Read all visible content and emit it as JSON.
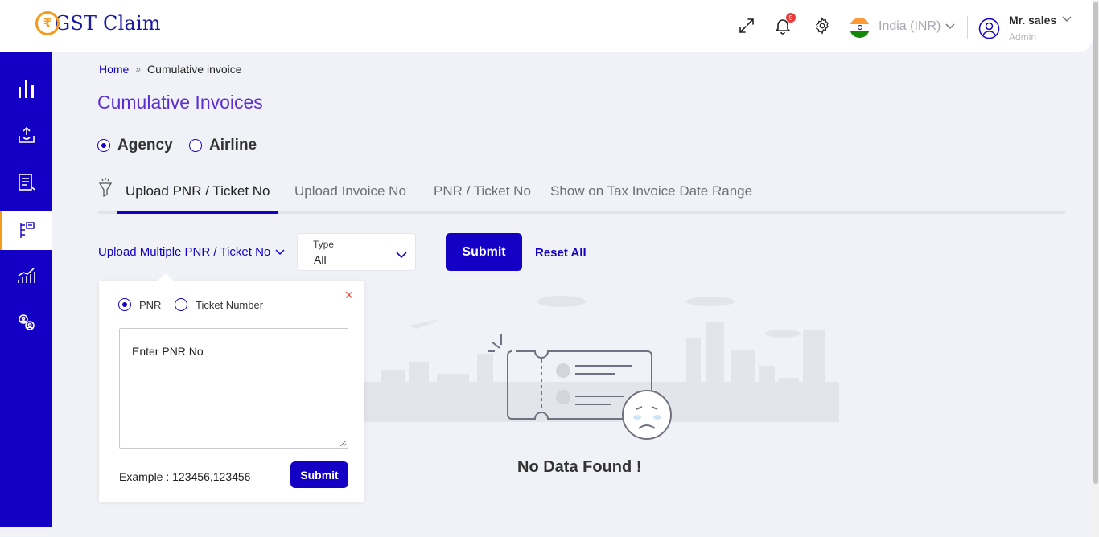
{
  "header": {
    "logo_text": "GST Claim",
    "logo_symbol": "₹",
    "notification_count": "5",
    "country": "India (INR)",
    "user_name": "Mr. sales",
    "user_role": "Admin"
  },
  "sidebar": {
    "items": [
      {
        "name": "dashboard",
        "icon": "bar-chart-icon"
      },
      {
        "name": "upload",
        "icon": "upload-tray-icon"
      },
      {
        "name": "invoice",
        "icon": "document-icon"
      },
      {
        "name": "cumulative-invoice",
        "icon": "cumulative-invoice-icon",
        "active": true
      },
      {
        "name": "reports",
        "icon": "growth-chart-icon"
      },
      {
        "name": "users",
        "icon": "users-icon"
      }
    ]
  },
  "breadcrumb": {
    "home": "Home",
    "separator": "»",
    "current": "Cumulative invoice"
  },
  "page_title": "Cumulative Invoices",
  "entity_options": {
    "agency": "Agency",
    "airline": "Airline",
    "selected": "Agency"
  },
  "tabs": [
    {
      "label": "Upload PNR / Ticket No",
      "active": true
    },
    {
      "label": "Upload Invoice No",
      "active": false
    },
    {
      "label": "PNR / Ticket No",
      "active": false
    },
    {
      "label": "Show on Tax Invoice Date Range",
      "active": false
    }
  ],
  "filters": {
    "upload_dropdown": "Upload Multiple PNR / Ticket No",
    "type_label": "Type",
    "type_value": "All",
    "submit_label": "Submit",
    "reset_label": "Reset All"
  },
  "popup": {
    "option_pnr": "PNR",
    "option_ticket": "Ticket Number",
    "selected": "PNR",
    "textarea_value": "Enter PNR No",
    "example_text": "Example : 123456,123456",
    "submit_label": "Submit",
    "close_symbol": "×"
  },
  "empty_state": {
    "message": "No Data Found !"
  },
  "colors": {
    "primary": "#1400c4",
    "accent": "#f29b1d",
    "title": "#5b2fd1",
    "close": "#e64a3b",
    "badge": "#ec3b3b"
  }
}
